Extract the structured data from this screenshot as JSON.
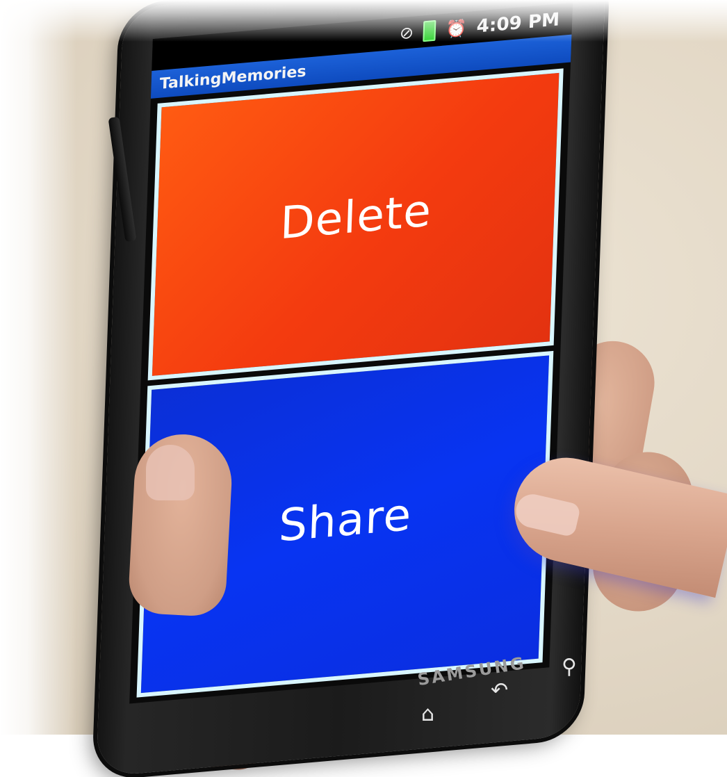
{
  "status_bar": {
    "time": "4:09 PM",
    "icons": [
      "no-sim-icon",
      "battery-icon",
      "alarm-icon"
    ]
  },
  "app": {
    "title": "TalkingMemories"
  },
  "tiles": [
    {
      "label": "Delete",
      "color": "#f4400f"
    },
    {
      "label": "Share",
      "color": "#0a33ea"
    }
  ],
  "device": {
    "brand": "SAMSUNG",
    "nav_icons": [
      "home-icon",
      "back-icon",
      "search-icon"
    ]
  }
}
